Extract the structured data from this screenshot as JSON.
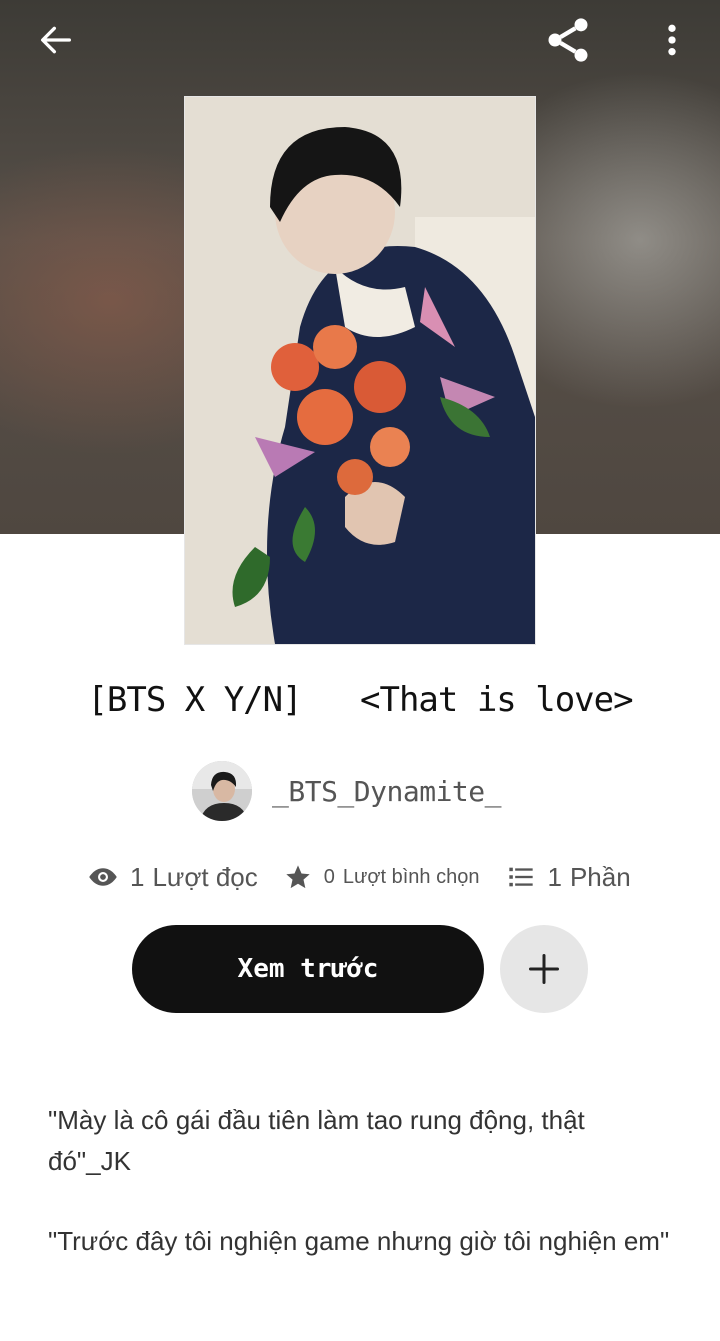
{
  "header": {
    "back_icon": "arrow-left-icon",
    "share_icon": "share-icon",
    "more_icon": "more-vertical-icon"
  },
  "story": {
    "title": "[BTS X Y/N]   <That is love>",
    "author": "_BTS_Dynamite_"
  },
  "stats": {
    "reads": {
      "icon": "eye-icon",
      "value": "1",
      "label": "Lượt đọc"
    },
    "votes": {
      "icon": "star-icon",
      "value": "0",
      "label": "Lượt bình chọn"
    },
    "parts": {
      "icon": "list-icon",
      "value": "1",
      "label": "Phần"
    }
  },
  "actions": {
    "preview_label": "Xem trước",
    "add_icon": "plus-icon"
  },
  "description": {
    "line1": "\"Mày là cô gái đầu tiên làm tao rung động, thật đó\"_JK",
    "line2": "\"Trước đây tôi nghiện game nhưng giờ tôi nghiện em\""
  },
  "colors": {
    "primary_button": "#111111",
    "secondary_button": "#e6e6e6",
    "text_muted": "#555555"
  }
}
